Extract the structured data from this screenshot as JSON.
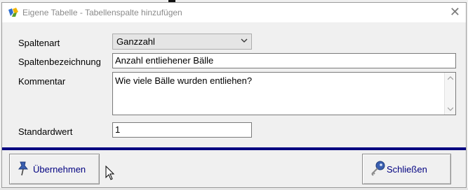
{
  "window": {
    "title": "Eigene Tabelle - Tabellenspalte hinzufügen",
    "close_glyph": "✕"
  },
  "form": {
    "spaltenart": {
      "label": "Spaltenart",
      "value": "Ganzzahl"
    },
    "bezeichnung": {
      "label": "Spaltenbezeichnung",
      "value": "Anzahl entliehener Bälle"
    },
    "kommentar": {
      "label": "Kommentar",
      "value": "Wie viele Bälle wurden entliehen?"
    },
    "standardwert": {
      "label": "Standardwert",
      "value": "1"
    }
  },
  "buttons": {
    "uebernehmen": {
      "label": "Übernehmen",
      "icon": "pushpin-icon"
    },
    "schliessen": {
      "label": "Schließen",
      "icon": "key-icon"
    }
  },
  "colors": {
    "accent": "#000080",
    "button_text": "#000080",
    "title_text": "#8a8a8a"
  }
}
